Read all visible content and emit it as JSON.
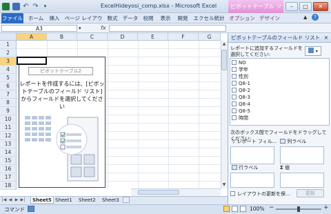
{
  "titlebar": {
    "title": "ExcelHideyosi_comp.xlsx - Microsoft Excel",
    "context_tab": "ピボットテーブル ツール",
    "min": "–",
    "max": "□",
    "close": "✕"
  },
  "ribbon": {
    "tabs": [
      "ファイル",
      "ホーム",
      "挿入",
      "ページ レイアウト",
      "数式",
      "データ",
      "校閲",
      "表示",
      "開発",
      "エクセル統計",
      "オプション",
      "デザイン"
    ]
  },
  "formula_bar": {
    "name_box": "A3",
    "fx": "fx",
    "formula": ""
  },
  "grid": {
    "columns": [
      "A",
      "B",
      "C",
      "D",
      "E",
      "F",
      "G"
    ],
    "rows": [
      "1",
      "2",
      "3",
      "4",
      "5",
      "6",
      "7",
      "8",
      "9",
      "10",
      "11",
      "12",
      "13",
      "14",
      "15",
      "16",
      "17",
      "18"
    ],
    "selected_column": "A",
    "selected_row": "3"
  },
  "pivot_placeholder": {
    "name": "ピボットテーブル2",
    "instructions": "レポートを作成するには、[ピボットテーブルのフィールド リスト] からフィールドを選択してください"
  },
  "sheet_tabs": [
    "Sheet5",
    "Sheet1",
    "Sheet2",
    "Sheet3"
  ],
  "status": {
    "mode": "コマンド",
    "zoom": "100%",
    "zoom_minus": "−",
    "zoom_plus": "+",
    "zoom_level": 0.5
  },
  "field_pane": {
    "title": "ピボットテーブルのフィールド リスト",
    "close": "×",
    "prompt": "レポートに追加するフィールドを選択してください:",
    "fields": [
      "NO",
      "学年",
      "性別",
      "Q8-1",
      "Q8-2",
      "Q8-3",
      "Q8-4",
      "Q8-5",
      "時間"
    ],
    "drag_prompt": "次のボックス間でフィールドをドラッグしてください:",
    "areas": {
      "filter": "レポート フィル...",
      "columns": "列ラベル",
      "rows": "行ラベル",
      "values": "値"
    },
    "defer_label": "レイアウトの更新を保...",
    "update_button": "更新"
  },
  "colors": {
    "file_tab": "#2a6cc4",
    "context_tab": "#e08fd5",
    "selected_header": "#f8d47a"
  }
}
